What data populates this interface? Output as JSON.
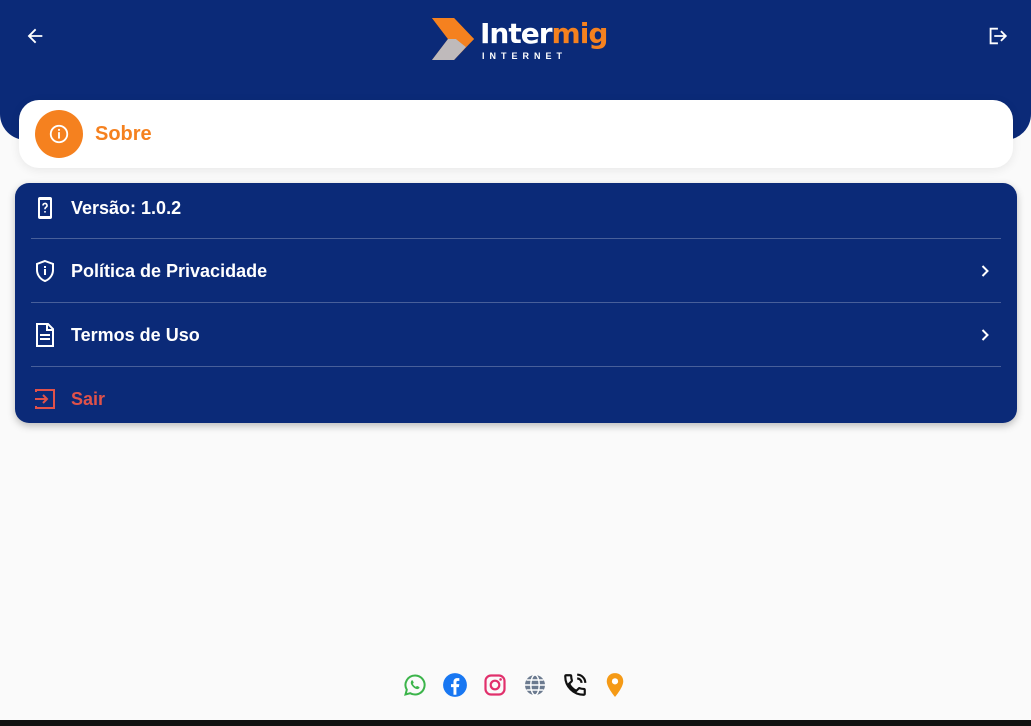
{
  "header": {
    "back_icon": "arrow-left-icon",
    "logout_icon": "logout-icon",
    "logo": {
      "word_white": "Inter",
      "word_orange": "mig",
      "subtitle": "INTERNET"
    }
  },
  "section": {
    "icon": "info-icon",
    "title": "Sobre"
  },
  "menu": {
    "items": [
      {
        "icon": "phone-help-icon",
        "label": "Versão: 1.0.2"
      },
      {
        "icon": "shield-info-icon",
        "label": "Política de Privacidade",
        "chevron": true
      },
      {
        "icon": "document-icon",
        "label": "Termos de Uso",
        "chevron": true
      },
      {
        "icon": "exit-icon",
        "label": "Sair"
      }
    ]
  },
  "social": [
    "whatsapp-icon",
    "facebook-icon",
    "instagram-icon",
    "website-icon",
    "phone-icon",
    "location-icon"
  ],
  "colors": {
    "primary": "#0b2a78",
    "accent": "#f5811f",
    "danger": "#e0524a",
    "whatsapp": "#3bb44a",
    "facebook": "#1877f2",
    "instagram": "#e1306c",
    "website": "#6b7a8f",
    "phone": "#111111",
    "location": "#f59a16"
  }
}
